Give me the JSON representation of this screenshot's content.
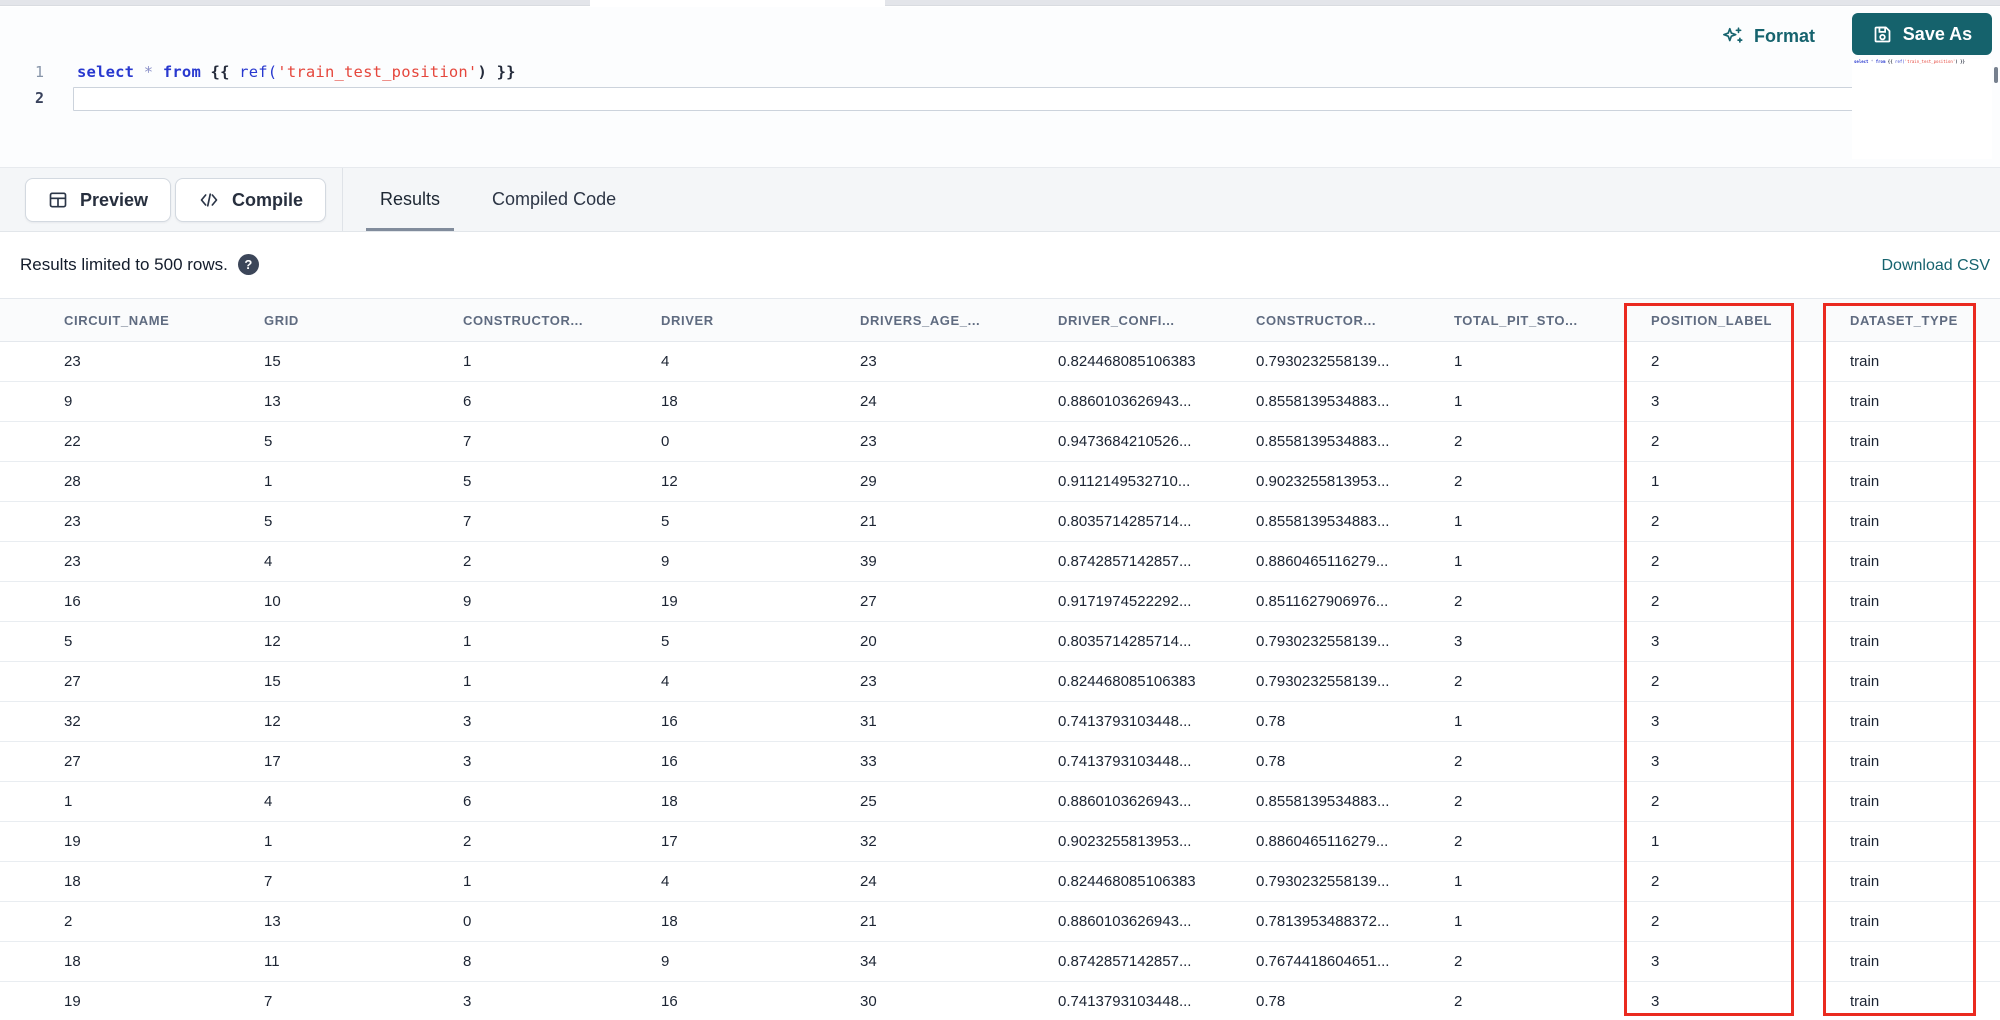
{
  "editor": {
    "line_numbers": [
      "1",
      "2"
    ],
    "code_tokens": [
      {
        "text": "select",
        "type": "keyword"
      },
      {
        "text": " ",
        "type": "plain"
      },
      {
        "text": "*",
        "type": "operator"
      },
      {
        "text": " ",
        "type": "plain"
      },
      {
        "text": "from",
        "type": "keyword"
      },
      {
        "text": " ",
        "type": "plain"
      },
      {
        "text": "{{",
        "type": "bracket"
      },
      {
        "text": " ",
        "type": "plain"
      },
      {
        "text": "ref(",
        "type": "function"
      },
      {
        "text": "'train_test_position'",
        "type": "string"
      },
      {
        "text": ")",
        "type": "bracket"
      },
      {
        "text": " ",
        "type": "plain"
      },
      {
        "text": "}}",
        "type": "bracket"
      }
    ],
    "format_label": "Format",
    "save_as_label": "Save As"
  },
  "action_bar": {
    "preview_label": "Preview",
    "compile_label": "Compile",
    "tabs": [
      {
        "label": "Results",
        "active": true
      },
      {
        "label": "Compiled Code",
        "active": false
      }
    ]
  },
  "results_meta": {
    "limit_text": "Results limited to 500 rows.",
    "help_glyph": "?",
    "download_label": "Download CSV"
  },
  "table": {
    "columns": [
      "CIRCUIT_NAME",
      "GRID",
      "CONSTRUCTOR...",
      "DRIVER",
      "DRIVERS_AGE_...",
      "DRIVER_CONFI...",
      "CONSTRUCTOR...",
      "TOTAL_PIT_STO...",
      "POSITION_LABEL",
      "DATASET_TYPE"
    ],
    "highlighted_columns": [
      "POSITION_LABEL",
      "DATASET_TYPE"
    ],
    "rows": [
      [
        "23",
        "15",
        "1",
        "4",
        "23",
        "0.824468085106383",
        "0.7930232558139...",
        "1",
        "2",
        "train"
      ],
      [
        "9",
        "13",
        "6",
        "18",
        "24",
        "0.8860103626943...",
        "0.8558139534883...",
        "1",
        "3",
        "train"
      ],
      [
        "22",
        "5",
        "7",
        "0",
        "23",
        "0.9473684210526...",
        "0.8558139534883...",
        "2",
        "2",
        "train"
      ],
      [
        "28",
        "1",
        "5",
        "12",
        "29",
        "0.9112149532710...",
        "0.9023255813953...",
        "2",
        "1",
        "train"
      ],
      [
        "23",
        "5",
        "7",
        "5",
        "21",
        "0.8035714285714...",
        "0.8558139534883...",
        "1",
        "2",
        "train"
      ],
      [
        "23",
        "4",
        "2",
        "9",
        "39",
        "0.8742857142857...",
        "0.8860465116279...",
        "1",
        "2",
        "train"
      ],
      [
        "16",
        "10",
        "9",
        "19",
        "27",
        "0.9171974522292...",
        "0.8511627906976...",
        "2",
        "2",
        "train"
      ],
      [
        "5",
        "12",
        "1",
        "5",
        "20",
        "0.8035714285714...",
        "0.7930232558139...",
        "3",
        "3",
        "train"
      ],
      [
        "27",
        "15",
        "1",
        "4",
        "23",
        "0.824468085106383",
        "0.7930232558139...",
        "2",
        "2",
        "train"
      ],
      [
        "32",
        "12",
        "3",
        "16",
        "31",
        "0.7413793103448...",
        "0.78",
        "1",
        "3",
        "train"
      ],
      [
        "27",
        "17",
        "3",
        "16",
        "33",
        "0.7413793103448...",
        "0.78",
        "2",
        "3",
        "train"
      ],
      [
        "1",
        "4",
        "6",
        "18",
        "25",
        "0.8860103626943...",
        "0.8558139534883...",
        "2",
        "2",
        "train"
      ],
      [
        "19",
        "1",
        "2",
        "17",
        "32",
        "0.9023255813953...",
        "0.8860465116279...",
        "2",
        "1",
        "train"
      ],
      [
        "18",
        "7",
        "1",
        "4",
        "24",
        "0.824468085106383",
        "0.7930232558139...",
        "1",
        "2",
        "train"
      ],
      [
        "2",
        "13",
        "0",
        "18",
        "21",
        "0.8860103626943...",
        "0.7813953488372...",
        "1",
        "2",
        "train"
      ],
      [
        "18",
        "11",
        "8",
        "9",
        "34",
        "0.8742857142857...",
        "0.7674418604651...",
        "2",
        "3",
        "train"
      ],
      [
        "19",
        "7",
        "3",
        "16",
        "30",
        "0.7413793103448...",
        "0.78",
        "2",
        "3",
        "train"
      ]
    ]
  },
  "colors": {
    "accent_teal": "#16636e",
    "accent_dark": "#15626c",
    "highlight_red": "#ea2a1f"
  }
}
